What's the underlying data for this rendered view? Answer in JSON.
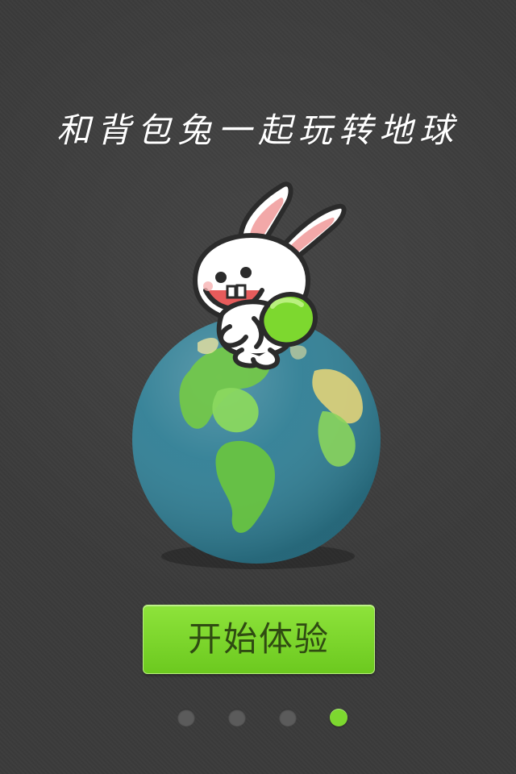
{
  "header": {
    "title": "和背包兔一起玩转地球"
  },
  "hero": {
    "illustration": "rabbit-on-globe-illustration"
  },
  "actions": {
    "start_label": "开始体验"
  },
  "pagination": {
    "total": 4,
    "active_index": 3
  },
  "colors": {
    "background": "#3b3b3b",
    "accent": "#7dd82f",
    "button_text": "#2f4b12",
    "inactive_dot": "#5b5b5b"
  }
}
